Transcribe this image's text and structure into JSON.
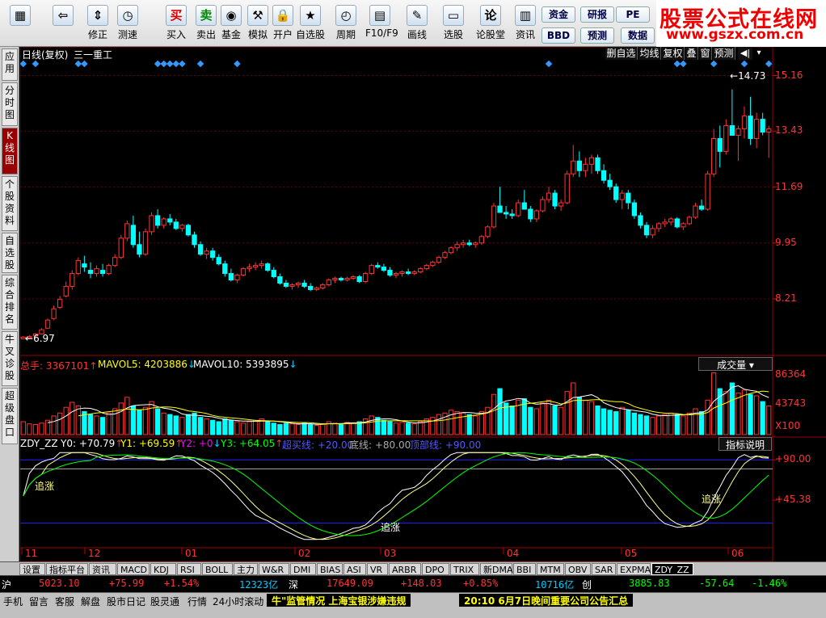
{
  "toolbar": {
    "buttons": [
      {
        "label": "",
        "icon": "grid"
      },
      {
        "label": "",
        "icon": "back-arrow"
      },
      {
        "label": "修正",
        "icon": "up-down"
      },
      {
        "label": "测速",
        "icon": "clock"
      },
      {
        "label": "买入",
        "icon": "buy"
      },
      {
        "label": "卖出",
        "icon": "sell"
      },
      {
        "label": "基金",
        "icon": "fund"
      },
      {
        "label": "模拟",
        "icon": "gavel"
      },
      {
        "label": "开户",
        "icon": "lock"
      },
      {
        "label": "自选股",
        "icon": "star"
      },
      {
        "label": "周期",
        "icon": "clock2"
      },
      {
        "label": "F10/F9",
        "icon": "doc"
      },
      {
        "label": "画线",
        "icon": "pen"
      },
      {
        "label": "选股",
        "icon": "monitor"
      },
      {
        "label": "论股堂",
        "icon": "chat"
      },
      {
        "label": "资讯",
        "icon": "page"
      },
      {
        "label": "资金",
        "icon": ""
      },
      {
        "label": "BBD",
        "icon": ""
      },
      {
        "label": "研报",
        "icon": ""
      },
      {
        "label": "预测",
        "icon": ""
      },
      {
        "label": "PE",
        "icon": ""
      },
      {
        "label": "数据",
        "icon": ""
      }
    ],
    "brand": {
      "name": "股票公式在线网",
      "url": "www.gszx.com.cn"
    }
  },
  "left_tabs": [
    "应用",
    "分时图",
    "K线图",
    "个股资料",
    "自选股",
    "综合排名",
    "牛叉诊股",
    "超级盘口"
  ],
  "active_left_tab": "K线图",
  "chart_header": {
    "period": "日线(复权)",
    "stock_name": "三一重工",
    "buttons": [
      "删自选",
      "均线",
      "复权",
      "叠",
      "窗",
      "预测"
    ]
  },
  "price_axis_labels": [
    "15.16",
    "13.43",
    "11.69",
    "9.95",
    "8.21"
  ],
  "annotations": {
    "high": "14.73",
    "low": "6.97"
  },
  "volume_header": {
    "total": "总手: 3367101",
    "mavol5": "MAVOL5: 4203886",
    "mavol10": "MAVOL10: 5393895",
    "panel_select": "成交量"
  },
  "volume_axis_labels": [
    "86364",
    "43743",
    "X100"
  ],
  "indicator_header": {
    "name": "ZDY_ZZ",
    "y0": "Y0: +70.79",
    "y1": "Y1: +69.59",
    "y2": "Y2: +0",
    "y3": "Y3: +64.05",
    "overbought": "超买线: +20.00",
    "bottom": "底线: +80.00",
    "top": "顶部线: +90.00",
    "explain": "指标说明"
  },
  "indicator_axis_labels": [
    "+90.00",
    "+45.38"
  ],
  "indicator_labels": [
    "追涨",
    "追涨",
    "追涨"
  ],
  "date_labels": [
    "11",
    "12",
    "01",
    "02",
    "03",
    "04",
    "05",
    "06"
  ],
  "bottom_tabs": [
    "设置",
    "指标平台",
    "资讯",
    "MACD",
    "KDJ",
    "RSI",
    "BOLL",
    "主力",
    "W&R",
    "DMI",
    "BIAS",
    "ASI",
    "VR",
    "ARBR",
    "DPO",
    "TRIX",
    "新DMA",
    "BBI",
    "MTM",
    "OBV",
    "SAR",
    "EXPMA",
    "ZDY_ZZ"
  ],
  "active_bottom_tab": "ZDY_ZZ",
  "index_bar": {
    "sh_label": "沪",
    "sh_value": "5023.10",
    "sh_change": "+75.99",
    "sh_pct": "+1.54%",
    "sh_amount": "12323亿",
    "sz_label": "深",
    "sz_value": "17649.09",
    "sz_change": "+148.03",
    "sz_pct": "+0.85%",
    "sz_amount": "10716亿",
    "cy_label": "创",
    "cy_value": "3885.83",
    "cy_change": "-57.64",
    "cy_pct": "-1.46%"
  },
  "status_bar": {
    "items": [
      "手机",
      "留言",
      "客服",
      "解盘",
      "股市日记",
      "股灵通",
      "行情",
      "24小时滚动"
    ],
    "news1": "牛\"监管情况 上海宝银涉嫌违规",
    "news2": "20:10 6月7日晚间重要公司公告汇总"
  },
  "chart_data": {
    "type": "candlestick",
    "price_range": [
      6.5,
      15.6
    ],
    "candles": [
      [
        6.97,
        7.05,
        6.95,
        7.02
      ],
      [
        7.0,
        7.08,
        6.98,
        7.04
      ],
      [
        7.06,
        7.15,
        7.02,
        7.12
      ],
      [
        7.12,
        7.3,
        7.1,
        7.25
      ],
      [
        7.3,
        7.6,
        7.28,
        7.55
      ],
      [
        7.6,
        8.0,
        7.55,
        7.9
      ],
      [
        7.95,
        8.3,
        7.9,
        8.2
      ],
      [
        8.3,
        8.75,
        8.25,
        8.6
      ],
      [
        8.6,
        9.1,
        8.5,
        9.0
      ],
      [
        9.0,
        9.5,
        8.95,
        9.4
      ],
      [
        9.3,
        9.55,
        9.05,
        9.2
      ],
      [
        9.1,
        9.35,
        8.85,
        9.0
      ],
      [
        9.0,
        9.25,
        8.9,
        9.15
      ],
      [
        9.1,
        9.3,
        8.9,
        9.0
      ],
      [
        9.0,
        9.3,
        8.95,
        9.25
      ],
      [
        9.25,
        9.6,
        9.2,
        9.5
      ],
      [
        9.5,
        10.2,
        9.45,
        10.1
      ],
      [
        10.1,
        10.65,
        10.0,
        10.55
      ],
      [
        10.5,
        10.8,
        9.8,
        9.9
      ],
      [
        9.9,
        10.3,
        9.5,
        9.6
      ],
      [
        9.6,
        10.4,
        9.55,
        10.3
      ],
      [
        10.3,
        10.9,
        10.2,
        10.8
      ],
      [
        10.8,
        11.0,
        10.4,
        10.5
      ],
      [
        10.5,
        10.75,
        10.4,
        10.7
      ],
      [
        10.7,
        10.85,
        10.5,
        10.6
      ],
      [
        10.6,
        10.7,
        10.35,
        10.4
      ],
      [
        10.4,
        10.55,
        10.3,
        10.5
      ],
      [
        10.5,
        10.55,
        10.15,
        10.2
      ],
      [
        10.2,
        10.3,
        9.8,
        9.9
      ],
      [
        9.9,
        10.0,
        9.55,
        9.6
      ],
      [
        9.6,
        9.8,
        9.45,
        9.7
      ],
      [
        9.7,
        9.8,
        9.4,
        9.5
      ],
      [
        9.5,
        9.6,
        9.25,
        9.3
      ],
      [
        9.3,
        9.4,
        8.9,
        9.0
      ],
      [
        9.0,
        9.15,
        8.75,
        8.8
      ],
      [
        8.8,
        9.0,
        8.7,
        8.95
      ],
      [
        8.95,
        9.2,
        8.9,
        9.15
      ],
      [
        9.15,
        9.3,
        9.05,
        9.2
      ],
      [
        9.2,
        9.35,
        9.1,
        9.25
      ],
      [
        9.25,
        9.4,
        9.15,
        9.3
      ],
      [
        9.3,
        9.35,
        9.05,
        9.1
      ],
      [
        9.1,
        9.2,
        8.85,
        8.9
      ],
      [
        8.9,
        9.0,
        8.65,
        8.7
      ],
      [
        8.7,
        8.8,
        8.55,
        8.6
      ],
      [
        8.6,
        8.7,
        8.5,
        8.65
      ],
      [
        8.65,
        8.75,
        8.55,
        8.7
      ],
      [
        8.7,
        8.8,
        8.55,
        8.6
      ],
      [
        8.6,
        8.7,
        8.45,
        8.5
      ],
      [
        8.5,
        8.6,
        8.45,
        8.55
      ],
      [
        8.55,
        8.7,
        8.5,
        8.65
      ],
      [
        8.65,
        8.85,
        8.6,
        8.8
      ],
      [
        8.8,
        8.9,
        8.7,
        8.85
      ],
      [
        8.85,
        8.9,
        8.75,
        8.8
      ],
      [
        8.8,
        8.9,
        8.75,
        8.85
      ],
      [
        8.85,
        8.95,
        8.8,
        8.9
      ],
      [
        8.9,
        8.95,
        8.7,
        8.75
      ],
      [
        8.75,
        9.05,
        8.7,
        9.0
      ],
      [
        9.0,
        9.3,
        8.95,
        9.25
      ],
      [
        9.25,
        9.35,
        9.15,
        9.2
      ],
      [
        9.2,
        9.3,
        9.05,
        9.1
      ],
      [
        9.1,
        9.2,
        8.9,
        8.95
      ],
      [
        8.95,
        9.05,
        8.85,
        9.0
      ],
      [
        9.0,
        9.1,
        8.9,
        9.05
      ],
      [
        9.05,
        9.15,
        8.95,
        9.0
      ],
      [
        9.0,
        9.1,
        8.95,
        9.05
      ],
      [
        9.05,
        9.2,
        9.0,
        9.15
      ],
      [
        9.15,
        9.3,
        9.1,
        9.25
      ],
      [
        9.25,
        9.4,
        9.2,
        9.35
      ],
      [
        9.35,
        9.55,
        9.3,
        9.5
      ],
      [
        9.5,
        9.7,
        9.45,
        9.65
      ],
      [
        9.65,
        9.85,
        9.6,
        9.8
      ],
      [
        9.8,
        10.0,
        9.7,
        9.9
      ],
      [
        9.9,
        10.05,
        9.8,
        9.95
      ],
      [
        9.95,
        10.05,
        9.85,
        9.9
      ],
      [
        9.9,
        10.0,
        9.8,
        9.95
      ],
      [
        9.95,
        10.2,
        9.9,
        10.15
      ],
      [
        10.15,
        10.5,
        10.1,
        10.45
      ],
      [
        10.45,
        11.2,
        10.4,
        11.1
      ],
      [
        11.1,
        11.7,
        11.0,
        10.9
      ],
      [
        10.9,
        11.1,
        10.7,
        10.85
      ],
      [
        10.85,
        11.0,
        10.7,
        10.8
      ],
      [
        10.8,
        11.3,
        10.75,
        11.2
      ],
      [
        11.2,
        11.6,
        11.1,
        11.0
      ],
      [
        11.0,
        11.1,
        10.6,
        10.7
      ],
      [
        10.7,
        11.0,
        10.6,
        10.95
      ],
      [
        10.95,
        11.4,
        10.9,
        11.3
      ],
      [
        11.3,
        11.7,
        11.2,
        11.5
      ],
      [
        11.5,
        11.6,
        11.0,
        11.1
      ],
      [
        11.1,
        11.3,
        10.95,
        11.2
      ],
      [
        11.2,
        12.2,
        11.15,
        12.1
      ],
      [
        12.1,
        13.0,
        12.0,
        12.5
      ],
      [
        12.5,
        12.8,
        12.0,
        12.2
      ],
      [
        12.2,
        12.6,
        12.0,
        12.4
      ],
      [
        12.4,
        12.7,
        12.1,
        12.6
      ],
      [
        12.6,
        12.7,
        12.1,
        12.2
      ],
      [
        12.2,
        12.4,
        11.8,
        11.9
      ],
      [
        11.9,
        12.1,
        11.6,
        11.7
      ],
      [
        11.7,
        11.8,
        11.2,
        11.3
      ],
      [
        11.3,
        11.6,
        11.0,
        11.5
      ],
      [
        11.5,
        11.6,
        11.0,
        11.2
      ],
      [
        11.2,
        11.3,
        10.7,
        10.8
      ],
      [
        10.8,
        10.9,
        10.4,
        10.5
      ],
      [
        10.5,
        10.6,
        10.1,
        10.2
      ],
      [
        10.2,
        10.5,
        10.1,
        10.4
      ],
      [
        10.4,
        10.6,
        10.3,
        10.55
      ],
      [
        10.55,
        10.7,
        10.45,
        10.6
      ],
      [
        10.6,
        10.75,
        10.5,
        10.7
      ],
      [
        10.7,
        10.75,
        10.4,
        10.45
      ],
      [
        10.45,
        10.6,
        10.35,
        10.55
      ],
      [
        10.55,
        10.8,
        10.5,
        10.75
      ],
      [
        10.75,
        11.2,
        10.7,
        11.1
      ],
      [
        11.1,
        11.3,
        10.95,
        11.0
      ],
      [
        11.0,
        12.2,
        10.95,
        12.1
      ],
      [
        12.1,
        13.5,
        12.0,
        13.2
      ],
      [
        13.2,
        13.6,
        12.3,
        12.8
      ],
      [
        12.8,
        13.8,
        12.7,
        13.6
      ],
      [
        13.6,
        14.73,
        13.4,
        13.3
      ],
      [
        13.3,
        13.6,
        12.5,
        13.5
      ],
      [
        13.5,
        14.2,
        13.2,
        13.9
      ],
      [
        13.9,
        14.5,
        13.0,
        13.2
      ],
      [
        13.2,
        14.0,
        12.9,
        13.8
      ],
      [
        13.8,
        14.0,
        13.3,
        13.4
      ],
      [
        13.4,
        13.6,
        12.6,
        13.5
      ]
    ],
    "volumes": [
      18,
      15,
      14,
      16,
      20,
      26,
      30,
      38,
      45,
      40,
      32,
      28,
      26,
      24,
      30,
      36,
      44,
      52,
      40,
      34,
      38,
      46,
      36,
      30,
      28,
      26,
      24,
      28,
      30,
      24,
      22,
      20,
      18,
      22,
      20,
      18,
      16,
      18,
      20,
      22,
      18,
      16,
      14,
      16,
      15,
      14,
      16,
      14,
      13,
      15,
      18,
      16,
      15,
      17,
      16,
      18,
      22,
      26,
      24,
      20,
      18,
      16,
      17,
      16,
      15,
      18,
      22,
      24,
      28,
      30,
      34,
      32,
      30,
      28,
      26,
      32,
      38,
      56,
      64,
      44,
      40,
      48,
      50,
      38,
      36,
      44,
      48,
      40,
      38,
      60,
      72,
      52,
      48,
      46,
      40,
      36,
      34,
      32,
      38,
      34,
      30,
      28,
      26,
      24,
      26,
      28,
      30,
      28,
      26,
      30,
      36,
      32,
      48,
      86,
      64,
      60,
      72,
      58,
      62,
      56,
      54,
      46,
      40
    ]
  }
}
